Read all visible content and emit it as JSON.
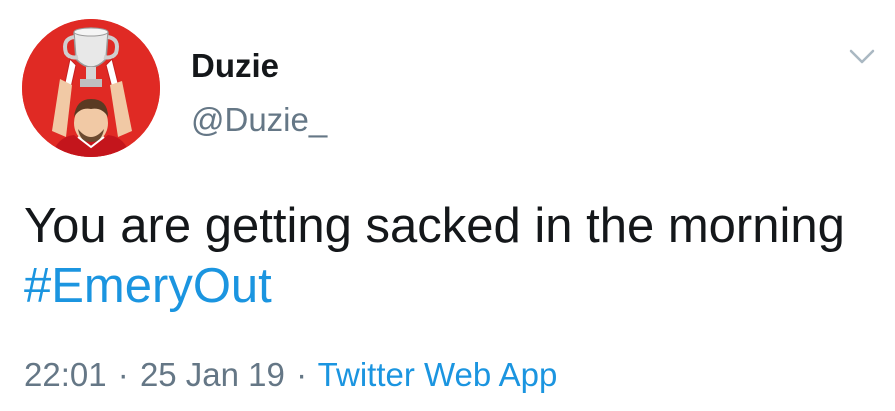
{
  "user": {
    "display_name": "Duzie",
    "handle": "@Duzie_",
    "avatar_icon": "avatar-trophy-illustration"
  },
  "tweet": {
    "text_prefix": "You are getting sacked in the morning ",
    "hashtag": "#EmeryOut",
    "time": "22:01",
    "separator": "·",
    "date": "25 Jan 19",
    "source": "Twitter Web App"
  },
  "menu": {
    "icon": "chevron-down-icon"
  },
  "colors": {
    "link": "#1b95e0",
    "secondary_text": "#657786",
    "primary_text": "#14171a",
    "avatar_bg": "#e02a24"
  }
}
